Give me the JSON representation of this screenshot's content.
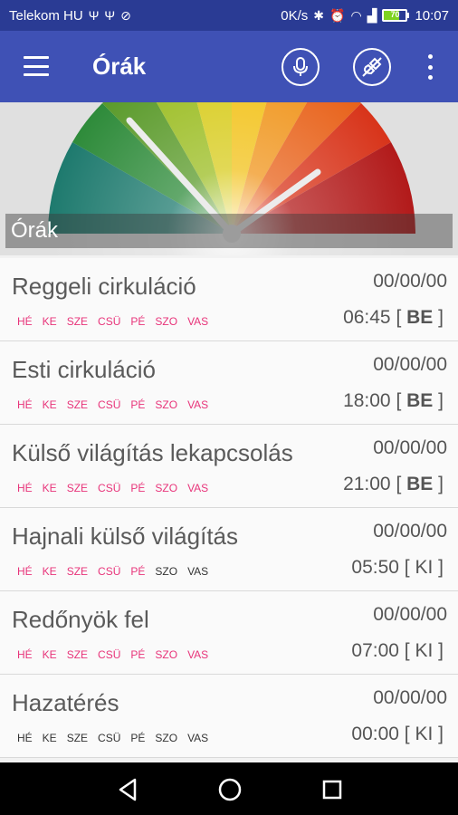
{
  "status_bar": {
    "carrier": "Telekom HU",
    "speed": "0K/s",
    "battery": "70",
    "time": "10:07"
  },
  "app_bar": {
    "title": "Órák"
  },
  "header": {
    "label": "Órák"
  },
  "days": [
    "HÉ",
    "KE",
    "SZE",
    "CSÜ",
    "PÉ",
    "SZO",
    "VAS"
  ],
  "colors": {
    "statusbar": "#2a3b94",
    "appbar": "#3f51b5",
    "day_active": "#e8347a",
    "day_inactive": "#333333"
  },
  "timers": [
    {
      "name": "Reggeli cirkuláció",
      "date": "00/00/00",
      "time": "06:45",
      "state": "BE",
      "days_on": [
        true,
        true,
        true,
        true,
        true,
        true,
        true
      ]
    },
    {
      "name": "Esti cirkuláció",
      "date": "00/00/00",
      "time": "18:00",
      "state": "BE",
      "days_on": [
        true,
        true,
        true,
        true,
        true,
        true,
        true
      ]
    },
    {
      "name": "Külső világítás lekapcsolás",
      "date": "00/00/00",
      "time": "21:00",
      "state": "BE",
      "days_on": [
        true,
        true,
        true,
        true,
        true,
        true,
        true
      ]
    },
    {
      "name": "Hajnali külső világítás",
      "date": "00/00/00",
      "time": "05:50",
      "state": "KI",
      "days_on": [
        true,
        true,
        true,
        true,
        true,
        false,
        false
      ]
    },
    {
      "name": "Redőnyök fel",
      "date": "00/00/00",
      "time": "07:00",
      "state": "KI",
      "days_on": [
        true,
        true,
        true,
        true,
        true,
        true,
        true
      ]
    },
    {
      "name": "Hazatérés",
      "date": "00/00/00",
      "time": "00:00",
      "state": "KI",
      "days_on": [
        false,
        false,
        false,
        false,
        false,
        false,
        false
      ]
    }
  ]
}
